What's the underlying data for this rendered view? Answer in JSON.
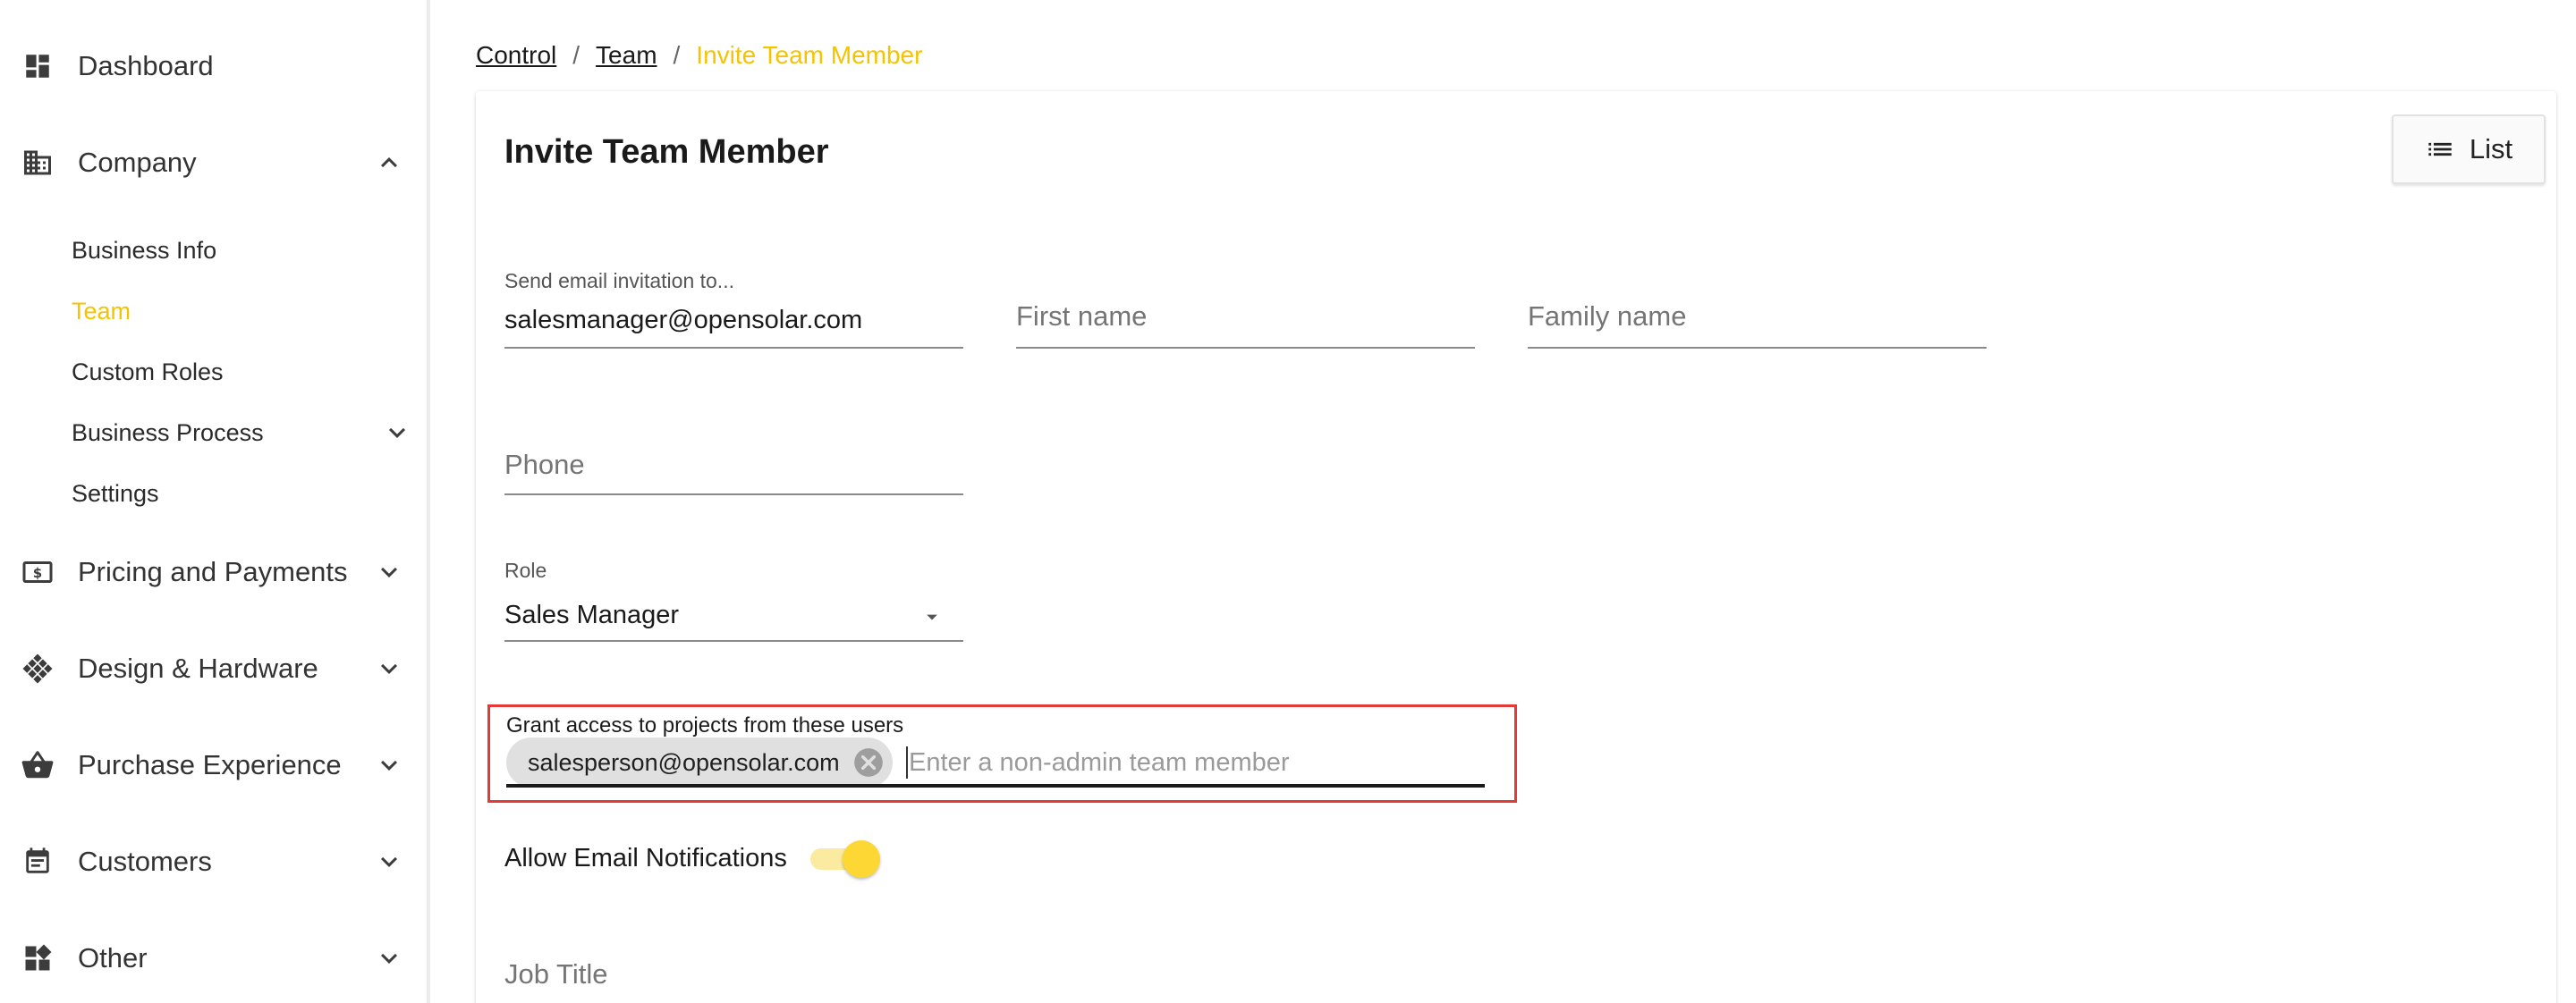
{
  "sidebar": {
    "dashboard": "Dashboard",
    "company": "Company",
    "company_items": [
      "Business Info",
      "Team",
      "Custom Roles",
      "Business Process",
      "Settings"
    ],
    "pricing": "Pricing and Payments",
    "design": "Design & Hardware",
    "purchase": "Purchase Experience",
    "customers": "Customers",
    "other": "Other"
  },
  "breadcrumb": {
    "control": "Control",
    "team": "Team",
    "current": "Invite Team Member",
    "separator": "/"
  },
  "page": {
    "title": "Invite Team Member",
    "list_button": "List"
  },
  "form": {
    "email_label": "Send email invitation to...",
    "email_value": "salesmanager@opensolar.com",
    "first_name_placeholder": "First name",
    "family_name_placeholder": "Family name",
    "phone_placeholder": "Phone",
    "role_label": "Role",
    "role_value": "Sales Manager",
    "grant_label": "Grant access to projects from these users",
    "grant_chip": "salesperson@opensolar.com",
    "grant_placeholder": "Enter a non-admin team member",
    "notifications_label": "Allow Email Notifications",
    "notifications_on": true,
    "job_title_placeholder": "Job Title"
  },
  "colors": {
    "accent": "#f5c400",
    "highlight_border": "#e53935",
    "toggle_knob": "#fdd835"
  },
  "icons": {
    "dashboard": "dashboard-icon",
    "company": "building-icon",
    "pricing": "dollar-bill-icon",
    "design": "grid-diamond-icon",
    "purchase": "basket-icon",
    "customers": "calendar-list-icon",
    "other": "widgets-icon",
    "list": "list-icon",
    "chip_delete": "close-circle-icon"
  }
}
